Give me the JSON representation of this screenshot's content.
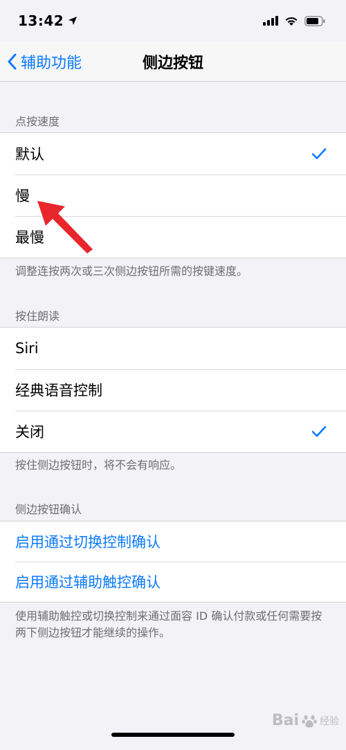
{
  "status_bar": {
    "time": "13:42"
  },
  "nav": {
    "back_label": "辅助功能",
    "title": "侧边按钮"
  },
  "click_speed": {
    "header": "点按速度",
    "options": [
      {
        "label": "默认",
        "selected": true
      },
      {
        "label": "慢",
        "selected": false
      },
      {
        "label": "最慢",
        "selected": false
      }
    ],
    "footer": "调整连按两次或三次侧边按钮所需的按键速度。"
  },
  "press_and_hold": {
    "header": "按住朗读",
    "options": [
      {
        "label": "Siri",
        "selected": false
      },
      {
        "label": "经典语音控制",
        "selected": false
      },
      {
        "label": "关闭",
        "selected": true
      }
    ],
    "footer": "按住侧边按钮时，将不会有响应。"
  },
  "confirm": {
    "header": "侧边按钮确认",
    "options": [
      {
        "label": "启用通过切换控制确认"
      },
      {
        "label": "启用通过辅助触控确认"
      }
    ],
    "footer": "使用辅助触控或切换控制来通过面容 ID 确认付款或任何需要按两下侧边按钮才能继续的操作。"
  },
  "watermark": {
    "brand": "Bai",
    "sub": "经验"
  },
  "colors": {
    "accent": "#0a7aff",
    "annotation_arrow": "#e8262b"
  }
}
